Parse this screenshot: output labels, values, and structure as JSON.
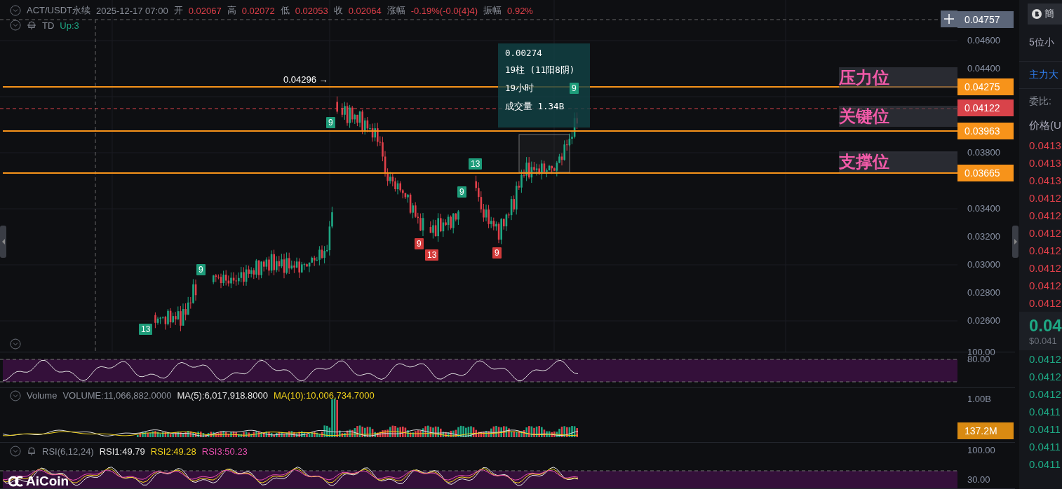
{
  "legend": {
    "symbol": "ACT/USDT永续",
    "time": "2025-12-17 07:00",
    "fields": [
      {
        "label": "开",
        "value": "0.02067"
      },
      {
        "label": "高",
        "value": "0.02072"
      },
      {
        "label": "低",
        "value": "0.02053"
      },
      {
        "label": "收",
        "value": "0.02064"
      },
      {
        "label": "涨幅",
        "value": "-0.19%(-0.0{4}4)"
      },
      {
        "label": "振幅",
        "value": "0.92%"
      }
    ]
  },
  "td_legend": {
    "name": "TD",
    "value": "Up:3"
  },
  "peak_label": "0.04296 →",
  "td_markers": [
    {
      "text": "13",
      "kind": "up"
    },
    {
      "text": "9",
      "kind": "up"
    },
    {
      "text": "9",
      "kind": "up"
    },
    {
      "text": "13",
      "kind": "up"
    },
    {
      "text": "9",
      "kind": "up"
    },
    {
      "text": "9",
      "kind": "up"
    },
    {
      "text": "9",
      "kind": "down"
    },
    {
      "text": "13",
      "kind": "down"
    },
    {
      "text": "9",
      "kind": "down"
    }
  ],
  "measure_tooltip": [
    "0.00274",
    "19柱 (11阳8阴)",
    "19小时",
    "成交量 1.34B"
  ],
  "levels": [
    {
      "label": "压力位",
      "price": "0.04275"
    },
    {
      "label": "关键位",
      "price": "0.03963"
    },
    {
      "label": "支撑位",
      "price": "0.03665"
    }
  ],
  "price_axis": {
    "ticks": [
      "0.04600",
      "0.04400",
      "0.03800",
      "0.03400",
      "0.03200",
      "0.03000",
      "0.02800",
      "0.02600"
    ],
    "badges": [
      {
        "text": "0.04757",
        "kind": "crosshair"
      },
      {
        "text": "0.04122",
        "kind": "last"
      }
    ]
  },
  "oscillator_axis": [
    "100.00",
    "80.00"
  ],
  "volume": {
    "title": "Volume",
    "values": [
      {
        "text": "VOLUME:11,066,882.0000",
        "color": "#8a8f99"
      },
      {
        "text": "MA(5):6,017,918.8000",
        "color": "#e6e6e6"
      },
      {
        "text": "MA(10):10,006,734.7000",
        "color": "#f2d31b"
      }
    ],
    "axis": "1.00B",
    "badge": "137.2M"
  },
  "rsi": {
    "title": "RSI(6,12,24)",
    "values": [
      {
        "text": "RSI1:49.79",
        "color": "#e6e6e6"
      },
      {
        "text": "RSI2:49.28",
        "color": "#f2d31b"
      },
      {
        "text": "RSI3:50.23",
        "color": "#e84fb0"
      }
    ],
    "axis": [
      "100.00",
      "30.00"
    ]
  },
  "logo": "AiCoin",
  "side_panel": {
    "button": "簡",
    "decimals": "5位小",
    "tab": "主力大",
    "ratio": "委比:",
    "price_header": "价格(U",
    "asks": [
      "0.0413",
      "0.0413",
      "0.0413",
      "0.0412",
      "0.0412",
      "0.0412",
      "0.0412",
      "0.0412",
      "0.0412",
      "0.0412"
    ],
    "last_price": "0.04",
    "last_usd": "$0.041",
    "bids": [
      "0.0412",
      "0.0412",
      "0.0412",
      "0.0411",
      "0.0411",
      "0.0411",
      "0.0411"
    ]
  }
}
